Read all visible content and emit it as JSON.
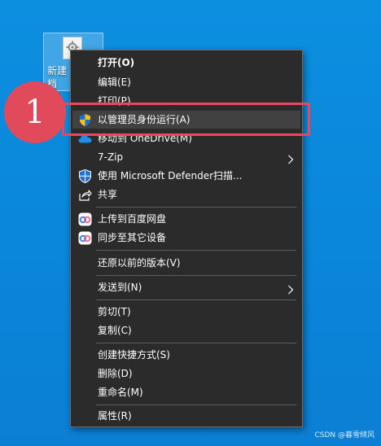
{
  "desktop": {
    "file_label": "新建\n档"
  },
  "menu": {
    "open": "打开(O)",
    "edit": "编辑(E)",
    "print": "打印(P)",
    "run_as_admin": "以管理员身份运行(A)",
    "move_to_onedrive": "移动到 OneDrive(M)",
    "seven_zip": "7-Zip",
    "defender": "使用 Microsoft Defender扫描...",
    "share": "共享",
    "upload_baidu": "上传到百度网盘",
    "sync_devices": "同步至其它设备",
    "restore_previous": "还原以前的版本(V)",
    "send_to": "发送到(N)",
    "cut": "剪切(T)",
    "copy": "复制(C)",
    "create_shortcut": "创建快捷方式(S)",
    "delete": "删除(D)",
    "rename": "重命名(M)",
    "properties": "属性(R)"
  },
  "annotation": {
    "step_number": "1",
    "highlight_color": "#e8485d"
  },
  "watermark": "CSDN @暮雪倾风"
}
